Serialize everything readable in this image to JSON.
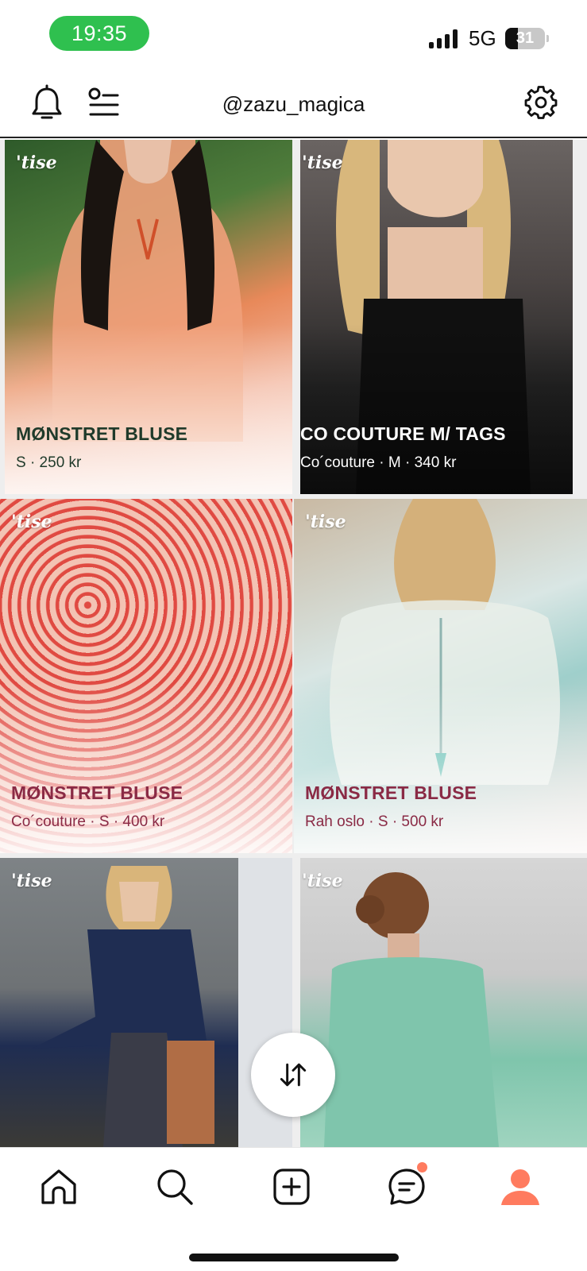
{
  "status_bar": {
    "time": "19:35",
    "network": "5G",
    "battery": "31",
    "battery_level": 0.31
  },
  "header": {
    "title": "@zazu_magica",
    "icons": [
      "bell-icon",
      "filter-list-icon",
      "gear-icon"
    ]
  },
  "listings": [
    {
      "brand_logo": "'tise",
      "title": "MØNSTRET BLUSE",
      "meta": "S · 250 kr",
      "title_color": "#1f3a2a",
      "meta_color": "#1f3a2a"
    },
    {
      "brand_logo": "'tise",
      "title": "CO COUTURE M/ TAGS",
      "meta": "Co´couture · M · 340 kr",
      "title_color": "#ffffff",
      "meta_color": "#ffffff"
    },
    {
      "brand_logo": "'tise",
      "title": "MØNSTRET BLUSE",
      "meta": "Co´couture · S · 400 kr",
      "title_color": "#8a2a45",
      "meta_color": "#8a2a45"
    },
    {
      "brand_logo": "'tise",
      "title": "MØNSTRET BLUSE",
      "meta": "Rah oslo · S · 500 kr",
      "title_color": "#8a2a45",
      "meta_color": "#8a2a45"
    },
    {
      "brand_logo": "'tise"
    },
    {
      "brand_logo": "'tise"
    }
  ],
  "fab": {
    "icon": "swap-vertical-icon"
  },
  "tab_bar": {
    "tabs": [
      "home-icon",
      "search-icon",
      "add-icon",
      "chat-icon",
      "profile-icon"
    ],
    "active_tab": "profile-icon",
    "accent": "#ff7b5f"
  }
}
